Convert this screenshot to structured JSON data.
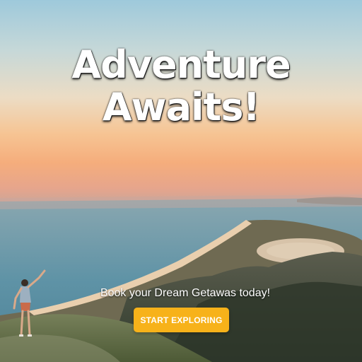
{
  "hero": {
    "headline_line1": "Adventure",
    "headline_line2": "Awaits!",
    "tagline": "Book your Dream Getawas today!",
    "cta_label": "START EXPLORING"
  },
  "colors": {
    "cta_background": "#f7b21a",
    "cta_text": "#ffffff",
    "headline_text": "#ffffff"
  }
}
